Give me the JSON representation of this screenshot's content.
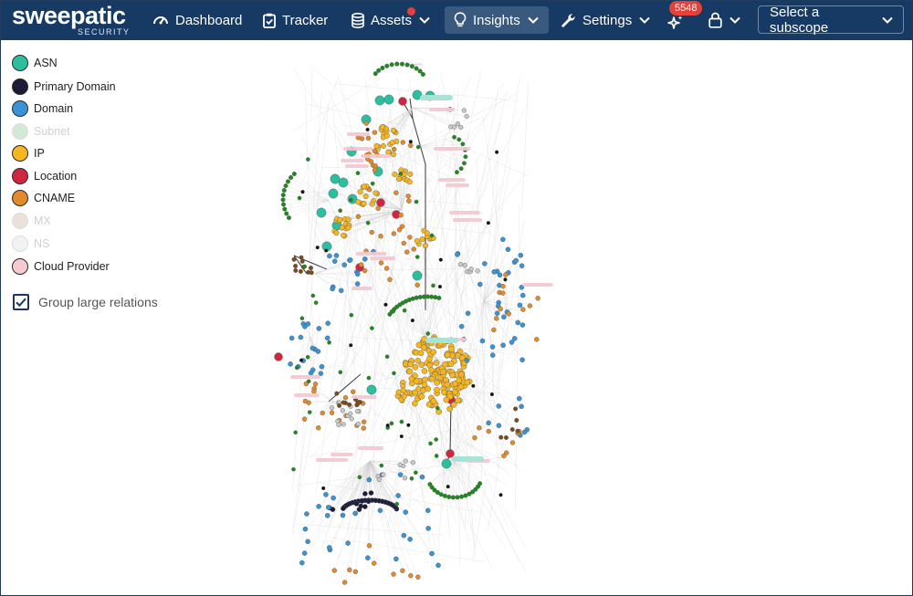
{
  "brand": {
    "name": "sweepatic",
    "subtitle": "SECURITY"
  },
  "nav": {
    "dashboard": "Dashboard",
    "tracker": "Tracker",
    "assets": "Assets",
    "insights": "Insights",
    "settings": "Settings",
    "notifications_count": "5548",
    "subscope_placeholder": "Select a subscope"
  },
  "legend": [
    {
      "label": "ASN",
      "color": "#2bbfa0",
      "enabled": true
    },
    {
      "label": "Primary Domain",
      "color": "#1b1b3a",
      "enabled": true
    },
    {
      "label": "Domain",
      "color": "#3a93d4",
      "enabled": true
    },
    {
      "label": "Subnet",
      "color": "#a8d5b0",
      "enabled": false
    },
    {
      "label": "IP",
      "color": "#f5b622",
      "enabled": true
    },
    {
      "label": "Location",
      "color": "#d0263f",
      "enabled": true
    },
    {
      "label": "CNAME",
      "color": "#e38a2a",
      "enabled": true
    },
    {
      "label": "MX",
      "color": "#d9c5b2",
      "enabled": false
    },
    {
      "label": "NS",
      "color": "#e6e6e6",
      "enabled": false
    },
    {
      "label": "Cloud Provider",
      "color": "#f7c9d0",
      "enabled": true
    }
  ],
  "group_toggle": {
    "label": "Group large relations",
    "checked": true
  },
  "colors": {
    "topbar": "#163a63",
    "asn": "#2bbfa0",
    "primary_domain": "#1b1b3a",
    "domain": "#3a93d4",
    "ip": "#f5b622",
    "location": "#d0263f",
    "cname": "#e38a2a",
    "ns": "#c9c9c9",
    "subnet_green": "#1e8a1e",
    "brown": "#7a4a1c"
  }
}
